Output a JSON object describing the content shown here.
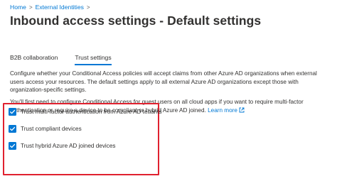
{
  "breadcrumb": {
    "items": [
      "Home",
      "External Identities"
    ],
    "separator": ">"
  },
  "page": {
    "title": "Inbound access settings - Default settings"
  },
  "tabs": [
    {
      "label": "B2B collaboration",
      "active": false
    },
    {
      "label": "Trust settings",
      "active": true
    }
  ],
  "description": {
    "paragraph1": "Configure whether your Conditional Access policies will accept claims from other Azure AD organizations when external users access your resources. The default settings apply to all external Azure AD organizations except those with organization-specific settings.",
    "paragraph2_text": "You'll first need to configure Conditional Access for guest users on all cloud apps if you want to require multi-factor authentication or require a device to be compliant or hybrid Azure AD joined.",
    "learn_more_label": "Learn more"
  },
  "checkboxes": [
    {
      "label": "Trust multi-factor authentication from Azure AD tenants",
      "checked": true
    },
    {
      "label": "Trust compliant devices",
      "checked": true
    },
    {
      "label": "Trust hybrid Azure AD joined devices",
      "checked": true
    }
  ],
  "colors": {
    "accent": "#0078d4",
    "highlight_border": "#e0212f",
    "text": "#323130"
  },
  "icons": {
    "external_link": "external-link-icon",
    "checkmark": "checkmark-icon",
    "breadcrumb_chevron": "chevron-right-icon"
  }
}
